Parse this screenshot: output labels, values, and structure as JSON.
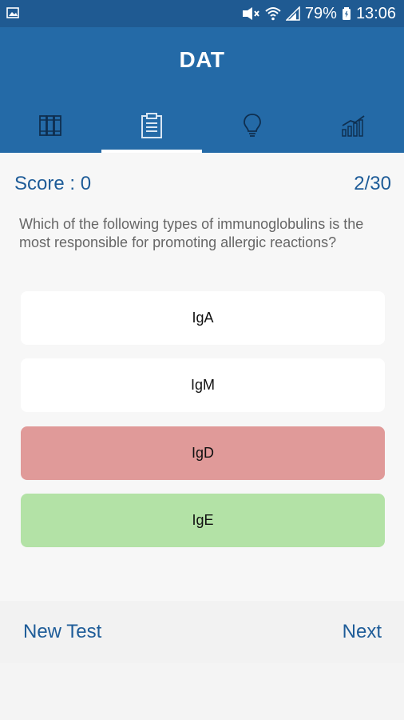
{
  "status_bar": {
    "battery": "79%",
    "time": "13:06",
    "icons": [
      "image-icon",
      "mute-icon",
      "wifi-icon",
      "signal-icon",
      "battery-icon"
    ]
  },
  "app": {
    "title": "DAT",
    "header_color": "#246aa7",
    "status_color": "#1f5a92",
    "accent": "#1e5c98"
  },
  "tabs": [
    {
      "icon": "book-icon",
      "active": false
    },
    {
      "icon": "clipboard-icon",
      "active": true
    },
    {
      "icon": "lightbulb-icon",
      "active": false
    },
    {
      "icon": "chart-icon",
      "active": false
    }
  ],
  "quiz": {
    "score_label": "Score : 0",
    "progress": "2/30",
    "question": "Which of the following types of immunoglobulins is the most responsible for promoting allergic reactions?",
    "options": [
      {
        "label": "IgA",
        "state": "default",
        "color": "#ffffff"
      },
      {
        "label": "IgM",
        "state": "default",
        "color": "#ffffff"
      },
      {
        "label": "IgD",
        "state": "incorrect",
        "color": "#e09a99"
      },
      {
        "label": "IgE",
        "state": "correct",
        "color": "#b3e2a6"
      }
    ]
  },
  "footer": {
    "new_test_label": "New Test",
    "next_label": "Next"
  }
}
